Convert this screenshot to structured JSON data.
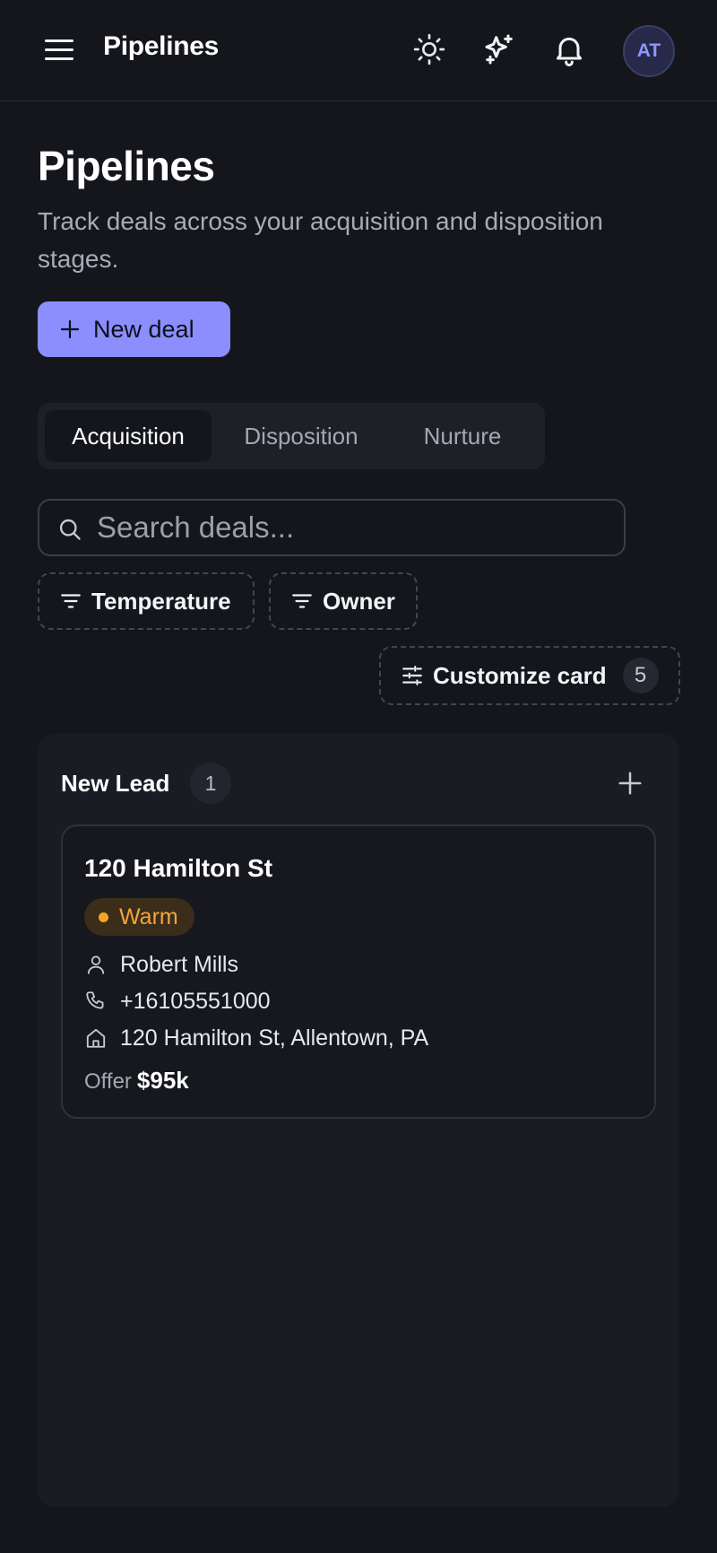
{
  "header": {
    "title": "Pipelines",
    "avatar_initials": "AT",
    "icons": [
      "menu-icon",
      "sun-icon",
      "sparkles-icon",
      "bell-icon"
    ]
  },
  "page": {
    "title": "Pipelines",
    "subtitle": "Track deals across your acquisition and disposition stages.",
    "new_deal_label": "New deal"
  },
  "tabs": [
    {
      "label": "Acquisition",
      "active": true
    },
    {
      "label": "Disposition",
      "active": false
    },
    {
      "label": "Nurture",
      "active": false
    }
  ],
  "search": {
    "placeholder": "Search deals...",
    "value": ""
  },
  "filters": {
    "temperature_label": "Temperature",
    "owner_label": "Owner",
    "customize_label": "Customize card",
    "customize_count": "5"
  },
  "column": {
    "title": "New Lead",
    "count": "1",
    "cards": [
      {
        "title": "120 Hamilton St",
        "temperature": "Warm",
        "contact": "Robert Mills",
        "phone": "+16105551000",
        "address": "120 Hamilton St, Allentown, PA",
        "offer_label": "Offer",
        "offer_value": "$95k"
      }
    ]
  },
  "colors": {
    "background": "#14161c",
    "accent": "#8b8efc",
    "warm": "#f5a524",
    "avatar_text": "#8e96ff"
  }
}
